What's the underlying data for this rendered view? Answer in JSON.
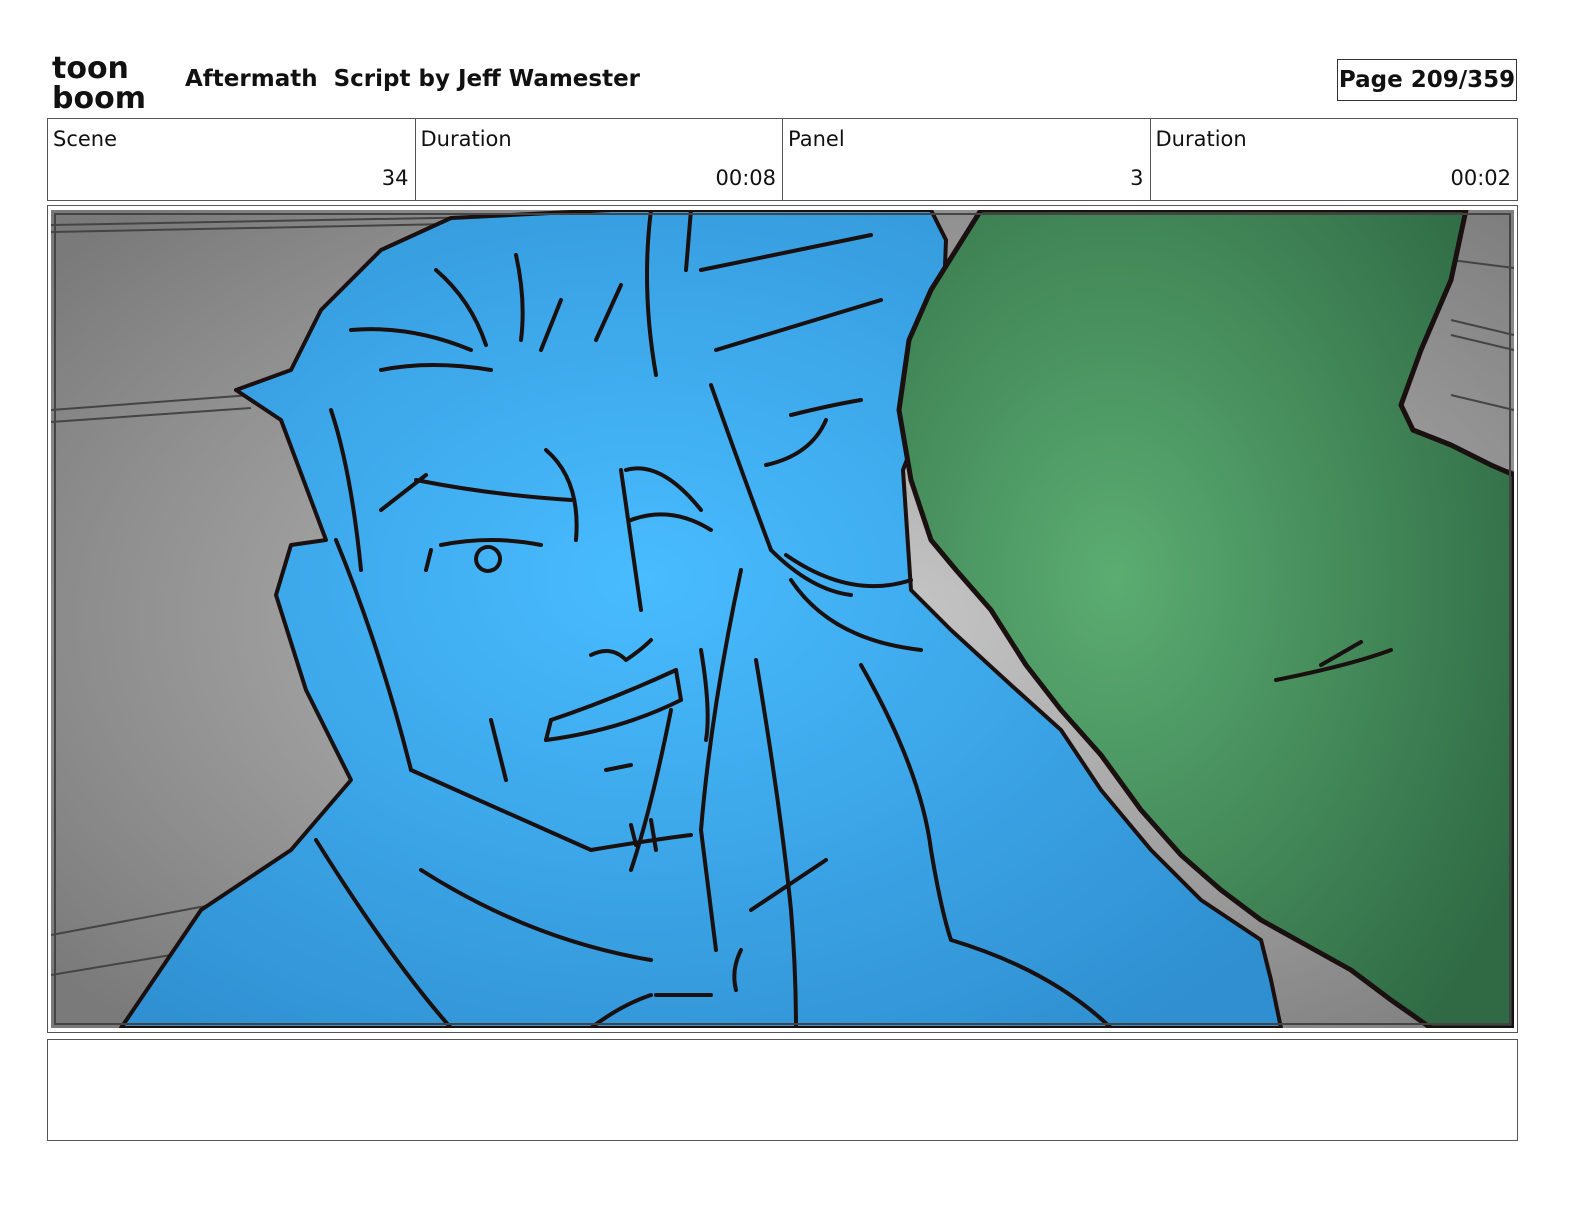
{
  "header": {
    "logo_text_top": "toon",
    "logo_text_bottom": "boom",
    "title": "Aftermath  Script by Jeff Wamester",
    "page": "Page 209/359"
  },
  "info": {
    "scene_label": "Scene",
    "scene_value": "34",
    "scene_duration_label": "Duration",
    "scene_duration_value": "00:08",
    "panel_label": "Panel",
    "panel_value": "3",
    "panel_duration_label": "Duration",
    "panel_duration_value": "00:02"
  },
  "panel": {
    "colors": {
      "background": "#9a9a9a",
      "figure_fill": "#45b5f5",
      "foreground_fill": "#56a66c",
      "line": "#1a1010"
    }
  },
  "notes": {
    "text": ""
  }
}
